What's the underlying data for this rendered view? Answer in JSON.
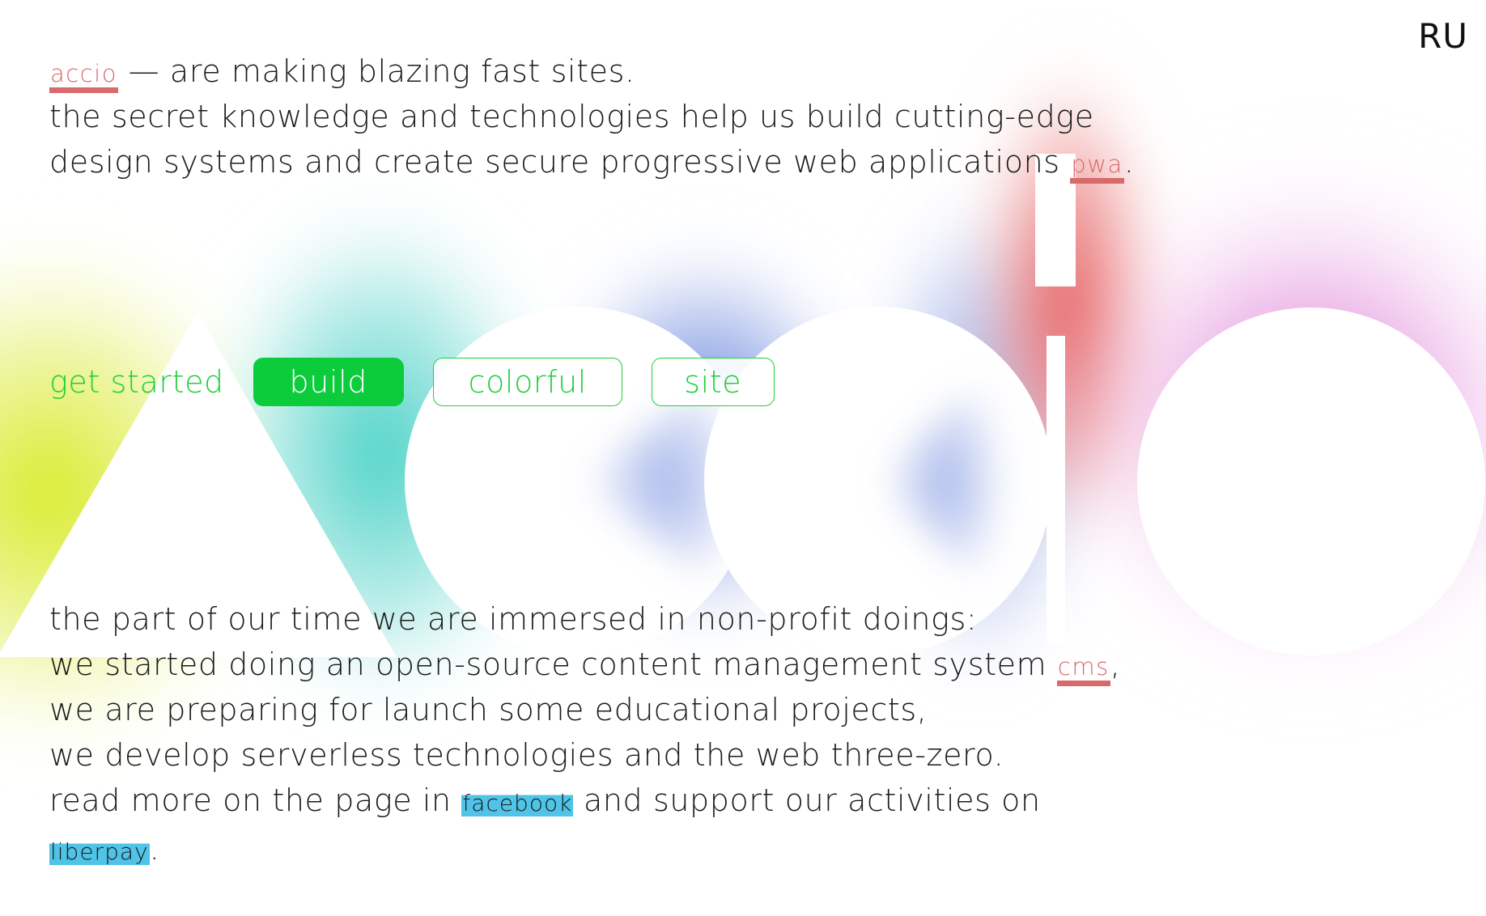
{
  "lang_switch": "RU",
  "intro": {
    "brand": "accio",
    "line1_rest": " — are making blazing fast sites.",
    "line2": "the secret knowledge and technologies help us build cutting-edge",
    "line3_start": "design systems and create secure progressive web applications ",
    "pwa": "pwa",
    "line3_end": "."
  },
  "actions": {
    "get_started": "get started",
    "pills": [
      "build",
      "colorful",
      "site"
    ],
    "active": "build"
  },
  "outro": {
    "line1": "the part of our time we are immersed in non-profit doings:",
    "line2_start": "we started doing an open-source content management system ",
    "cms": "cms",
    "line2_end": ",",
    "line3": "we are preparing for launch some educational projects,",
    "line4": "we develop serverless technologies and the web three-zero.",
    "line5_start": "read more on the page in ",
    "facebook": "facebook",
    "line5_end": " and support our activities on",
    "liberpay": "liberpay",
    "line6_end": "."
  },
  "colors": {
    "green": "#0ccc3c",
    "red_accent": "#d86a6a",
    "blue_highlight": "#4fc3e8"
  }
}
